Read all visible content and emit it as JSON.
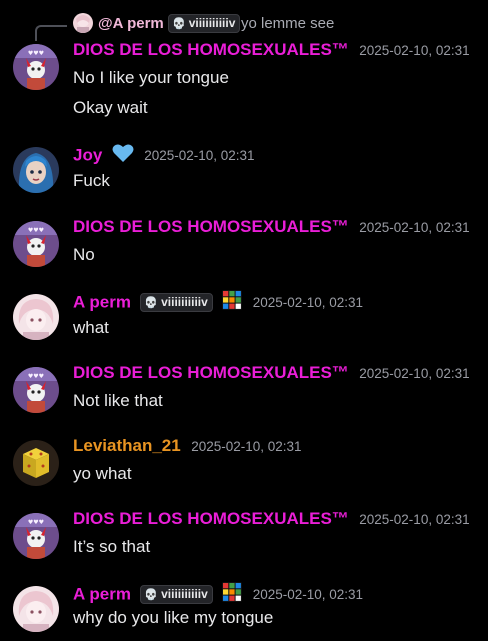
{
  "reply": {
    "author": "@A perm",
    "tag": "viiiiiiiiiiv",
    "text": "yo lemme see"
  },
  "messages": [
    {
      "author": "DIOS DE LOS HOMOSEXUALES™",
      "timestamp": "2025-02-10, 02:31",
      "lines": [
        "No I like your tongue",
        "Okay wait"
      ]
    },
    {
      "author": "Joy",
      "timestamp": "2025-02-10, 02:31",
      "lines": [
        "Fuck"
      ]
    },
    {
      "author": "DIOS DE LOS HOMOSEXUALES™",
      "timestamp": "2025-02-10, 02:31",
      "lines": [
        "No"
      ]
    },
    {
      "author": "A perm",
      "tag": "viiiiiiiiiiv",
      "timestamp": "2025-02-10, 02:31",
      "lines": [
        "what"
      ]
    },
    {
      "author": "DIOS DE LOS HOMOSEXUALES™",
      "timestamp": "2025-02-10, 02:31",
      "lines": [
        "Not like that"
      ]
    },
    {
      "author": "Leviathan_21",
      "timestamp": "2025-02-10, 02:31",
      "lines": [
        "yo what"
      ]
    },
    {
      "author": "DIOS DE LOS HOMOSEXUALES™",
      "timestamp": "2025-02-10, 02:31",
      "lines": [
        "It’s so that"
      ]
    },
    {
      "author": "A perm",
      "tag": "viiiiiiiiiiv",
      "timestamp": "2025-02-10, 02:31",
      "lines": [
        "why do you like my tongue"
      ]
    }
  ],
  "colors": {
    "background": "#000000",
    "username_pink": "#ea1ed7",
    "username_orange": "#e89422",
    "timestamp": "#9a9ca4",
    "text": "#e8e8ea"
  },
  "icons": {
    "skull": "skull-icon",
    "heart": "blue-heart-icon",
    "cube": "rubiks-cube-icon"
  }
}
